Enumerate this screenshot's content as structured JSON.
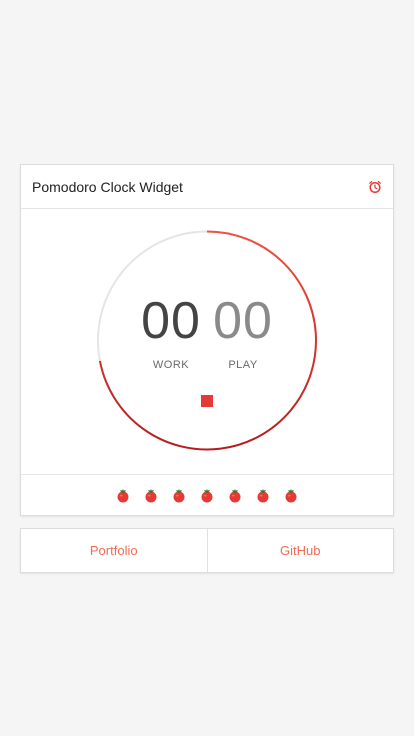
{
  "widget": {
    "title": "Pomodoro Clock Widget",
    "header_icon": "alarm-clock-icon",
    "accent_color": "#e53935",
    "work": {
      "value": "00",
      "label": "WORK"
    },
    "play": {
      "value": "00",
      "label": "PLAY"
    },
    "stop_icon": "stop-square-icon",
    "progress_fraction": 0.72,
    "completed_pomodoros": 7
  },
  "footer_links": [
    {
      "label": "Portfolio"
    },
    {
      "label": "GitHub"
    }
  ]
}
